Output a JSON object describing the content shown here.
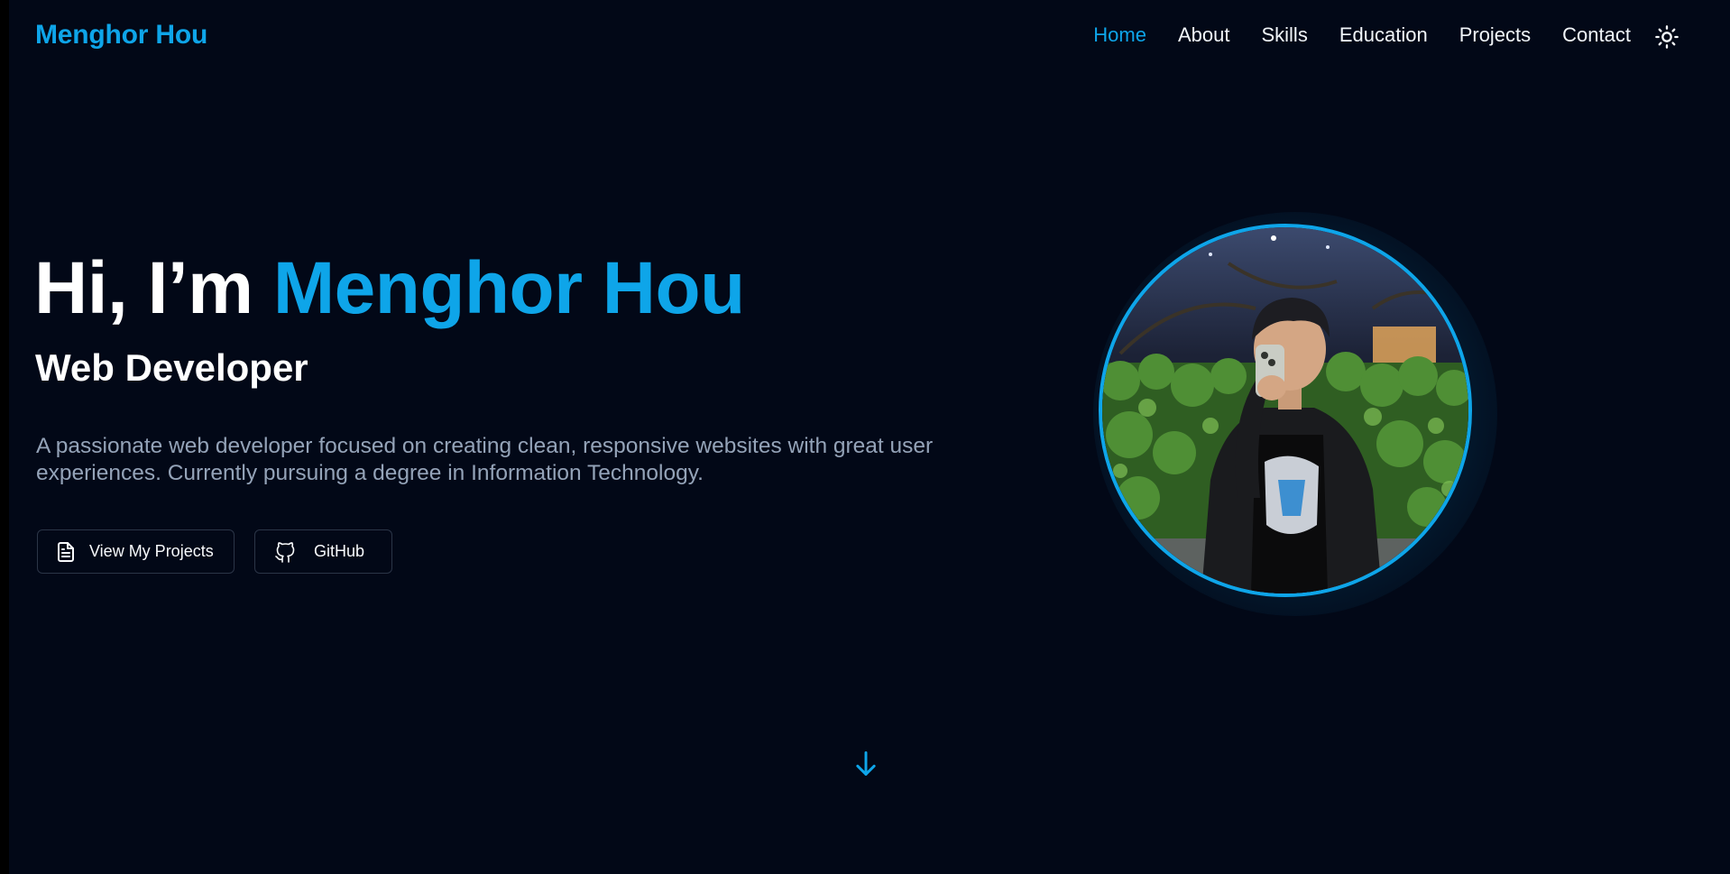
{
  "nav": {
    "brand": "Menghor Hou",
    "links": [
      "Home",
      "About",
      "Skills",
      "Education",
      "Projects",
      "Contact"
    ],
    "active": "Home",
    "theme_toggle_icon": "sun-icon"
  },
  "hero": {
    "greeting": "Hi, I’m ",
    "name": "Menghor Hou",
    "role": "Web Developer",
    "description": "A passionate web developer focused on creating clean, responsive websites with great user experiences. Currently pursuing a degree in Information Technology.",
    "buttons": {
      "projects": {
        "label": "View My Projects",
        "icon": "file-text-icon"
      },
      "github": {
        "label": "GitHub",
        "icon": "github-icon"
      }
    }
  },
  "profile": {
    "image": "profile-photo"
  },
  "scroll_indicator_icon": "arrow-down-icon",
  "colors": {
    "background": "#020817",
    "accent": "#0ea5e9",
    "text": "#ffffff",
    "muted": "#94a3b8",
    "border": "#2b3547"
  }
}
